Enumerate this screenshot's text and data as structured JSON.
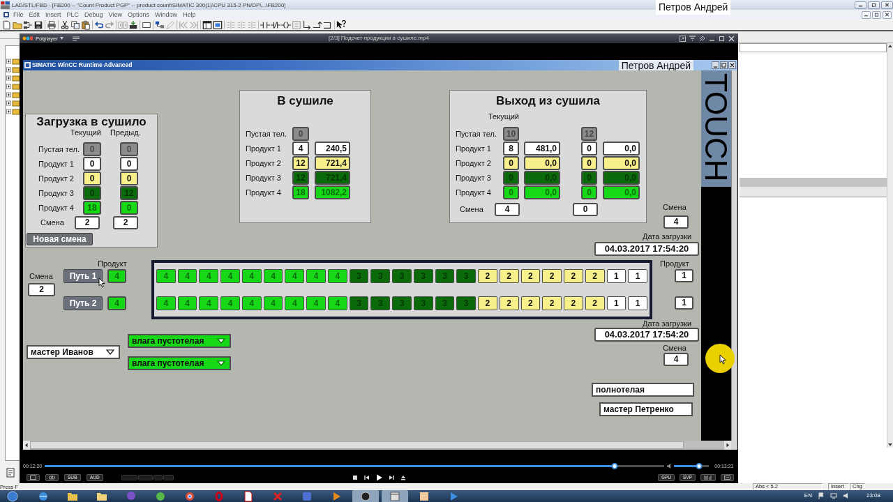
{
  "app_window": {
    "title": "LAD/STL/FBD  - [FB200 -- \"Count Product PGP\" -- product count\\SIMATIC 300(1)\\CPU 315-2 PN/DP\\...\\FB200]",
    "name_label": "Петров Андрей"
  },
  "menu": [
    "File",
    "Edit",
    "Insert",
    "PLC",
    "Debug",
    "View",
    "Options",
    "Window",
    "Help"
  ],
  "player": {
    "app_name": "Potplayer",
    "title": "[2/3] Подсчет продукции в сушиле.mp4",
    "elapsed": "00:12:20",
    "duration": "00:13:21",
    "seek": {
      "level": 0.92
    },
    "volume": {
      "level": 0.72
    },
    "left_buttons": [
      "SUB",
      "AUD"
    ],
    "right_buttons": [
      "GPU",
      "SVP"
    ]
  },
  "hmi": {
    "title": "SIMATIC WinCC Runtime Advanced",
    "name_label": "Петров Андрей",
    "side_label": "TOUCH",
    "loading": {
      "title": "Загрузка в сушило",
      "columns": [
        "Текущий",
        "Предыд."
      ],
      "rows": [
        {
          "label": "Пустая тел.",
          "color": "#8c8c8c",
          "values": [
            "0",
            "0"
          ]
        },
        {
          "label": "Продукт 1",
          "color": "#ffffff",
          "values": [
            "0",
            "0"
          ]
        },
        {
          "label": "Продукт 2",
          "color": "#f8f08a",
          "values": [
            "0",
            "0"
          ]
        },
        {
          "label": "Продукт 3",
          "color": "#0b6b0b",
          "values": [
            "0",
            "12"
          ]
        },
        {
          "label": "Продукт 4",
          "color": "#16d816",
          "values": [
            "18",
            "0"
          ]
        }
      ],
      "shift": {
        "label": "Смена",
        "values": [
          "2",
          "2"
        ]
      },
      "button": "Новая смена"
    },
    "in_dryer": {
      "title": "В сушиле",
      "rows": [
        {
          "label": "Пустая тел.",
          "color": "#8c8c8c",
          "values": [
            "0"
          ]
        },
        {
          "label": "Продукт 1",
          "color": "#ffffff",
          "values": [
            "4",
            "240,5"
          ]
        },
        {
          "label": "Продукт 2",
          "color": "#f8f08a",
          "values": [
            "12",
            "721,4"
          ]
        },
        {
          "label": "Продукт 3",
          "color": "#0b6b0b",
          "values": [
            "12",
            "721,4"
          ]
        },
        {
          "label": "Продукт 4",
          "color": "#16d816",
          "values": [
            "18",
            "1082,2"
          ]
        }
      ]
    },
    "exit": {
      "title": "Выход из сушила",
      "column_header": "Текущий",
      "rows": [
        {
          "label": "Пустая тел.",
          "color": "#8c8c8c",
          "groups": [
            [
              "10"
            ],
            [
              "12"
            ]
          ]
        },
        {
          "label": "Продукт 1",
          "color": "#ffffff",
          "groups": [
            [
              "8",
              "481,0"
            ],
            [
              "0",
              "0,0"
            ]
          ]
        },
        {
          "label": "Продукт 2",
          "color": "#f8f08a",
          "groups": [
            [
              "0",
              "0,0"
            ],
            [
              "0",
              "0,0"
            ]
          ]
        },
        {
          "label": "Продукт 3",
          "color": "#0b6b0b",
          "groups": [
            [
              "0",
              "0,0"
            ],
            [
              "0",
              "0,0"
            ]
          ]
        },
        {
          "label": "Продукт 4",
          "color": "#16d816",
          "groups": [
            [
              "0",
              "0,0"
            ],
            [
              "0",
              "0,0"
            ]
          ]
        }
      ],
      "shift": {
        "label": "Смена",
        "values": [
          "4",
          "0"
        ]
      }
    },
    "exit_info": {
      "shift_label": "Смена",
      "shift": "4",
      "date_label": "Дата загрузки",
      "date": "04.03.2017 17:54:20"
    },
    "lines": {
      "shift_label": "Смена",
      "shift": "2",
      "product_label": "Продукт",
      "end_label": "Продукт",
      "rows": [
        {
          "button": "Путь 1",
          "product": {
            "text": "4",
            "color": "#16d816"
          },
          "cells": [
            {
              "text": "4",
              "color": "#16d816"
            },
            {
              "text": "4",
              "color": "#16d816"
            },
            {
              "text": "4",
              "color": "#16d816"
            },
            {
              "text": "4",
              "color": "#16d816"
            },
            {
              "text": "4",
              "color": "#16d816"
            },
            {
              "text": "4",
              "color": "#16d816"
            },
            {
              "text": "4",
              "color": "#16d816"
            },
            {
              "text": "4",
              "color": "#16d816"
            },
            {
              "text": "4",
              "color": "#16d816"
            },
            {
              "text": "3",
              "color": "#0b6b0b"
            },
            {
              "text": "3",
              "color": "#0b6b0b"
            },
            {
              "text": "3",
              "color": "#0b6b0b"
            },
            {
              "text": "3",
              "color": "#0b6b0b"
            },
            {
              "text": "3",
              "color": "#0b6b0b"
            },
            {
              "text": "3",
              "color": "#0b6b0b"
            },
            {
              "text": "2",
              "color": "#f8f08a"
            },
            {
              "text": "2",
              "color": "#f8f08a"
            },
            {
              "text": "2",
              "color": "#f8f08a"
            },
            {
              "text": "2",
              "color": "#f8f08a"
            },
            {
              "text": "2",
              "color": "#f8f08a"
            },
            {
              "text": "2",
              "color": "#f8f08a"
            },
            {
              "text": "1",
              "color": "#ffffff"
            },
            {
              "text": "1",
              "color": "#ffffff"
            }
          ],
          "end": {
            "text": "1",
            "color": "#ffffff"
          }
        },
        {
          "button": "Путь 2",
          "product": {
            "text": "4",
            "color": "#16d816"
          },
          "cells": [
            {
              "text": "4",
              "color": "#16d816"
            },
            {
              "text": "4",
              "color": "#16d816"
            },
            {
              "text": "4",
              "color": "#16d816"
            },
            {
              "text": "4",
              "color": "#16d816"
            },
            {
              "text": "4",
              "color": "#16d816"
            },
            {
              "text": "4",
              "color": "#16d816"
            },
            {
              "text": "4",
              "color": "#16d816"
            },
            {
              "text": "4",
              "color": "#16d816"
            },
            {
              "text": "4",
              "color": "#16d816"
            },
            {
              "text": "3",
              "color": "#0b6b0b"
            },
            {
              "text": "3",
              "color": "#0b6b0b"
            },
            {
              "text": "3",
              "color": "#0b6b0b"
            },
            {
              "text": "3",
              "color": "#0b6b0b"
            },
            {
              "text": "3",
              "color": "#0b6b0b"
            },
            {
              "text": "3",
              "color": "#0b6b0b"
            },
            {
              "text": "2",
              "color": "#f8f08a"
            },
            {
              "text": "2",
              "color": "#f8f08a"
            },
            {
              "text": "2",
              "color": "#f8f08a"
            },
            {
              "text": "2",
              "color": "#f8f08a"
            },
            {
              "text": "2",
              "color": "#f8f08a"
            },
            {
              "text": "2",
              "color": "#f8f08a"
            },
            {
              "text": "1",
              "color": "#ffffff"
            },
            {
              "text": "1",
              "color": "#ffffff"
            }
          ],
          "end": {
            "text": "1",
            "color": "#ffffff"
          }
        }
      ]
    },
    "load_info": {
      "date_label": "Дата загрузки",
      "date": "04.03.2017 17:54:20",
      "shift_label": "Смена",
      "shift": "4"
    },
    "dropdowns": [
      {
        "text": "мастер Иванов",
        "color": "#ffffff"
      },
      {
        "text": "влага пустотелая",
        "color": "#16d816"
      },
      {
        "text": "влага пустотелая",
        "color": "#16d816"
      }
    ],
    "outputs": [
      "полнотелая",
      "мастер Петренко"
    ]
  },
  "status_bar": {
    "hint": "Press F",
    "position": "Abs < 5.2",
    "mode": "Insert",
    "change": "Chg"
  },
  "taskbar": {
    "apps": [
      {
        "selected": false
      },
      {
        "selected": false
      },
      {
        "selected": false
      },
      {
        "selected": false
      },
      {
        "selected": false
      },
      {
        "selected": false
      },
      {
        "selected": false
      },
      {
        "selected": false
      },
      {
        "selected": false
      },
      {
        "selected": false
      },
      {
        "selected": false
      },
      {
        "selected": true
      },
      {
        "selected": true
      },
      {
        "selected": false
      },
      {
        "selected": false
      }
    ],
    "language": "EN",
    "clock": "23:08"
  }
}
